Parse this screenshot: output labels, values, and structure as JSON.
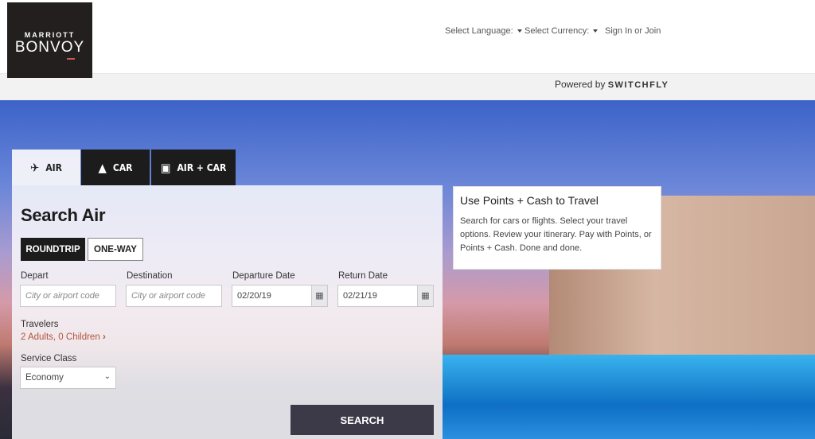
{
  "brand": {
    "line1": "MARRIOTT",
    "line2": "BONVOY"
  },
  "topnav": {
    "language": "Select Language:",
    "currency": "Select Currency:",
    "signin": "Sign In or Join"
  },
  "powered": {
    "prefix": "Powered by",
    "brand": "SWITCHFLY"
  },
  "tabs": [
    {
      "label": "AIR",
      "icon": "plane-icon",
      "active": true
    },
    {
      "label": "CAR",
      "icon": "road-icon"
    },
    {
      "label": "AIR + CAR",
      "icon": "suitcase-icon"
    }
  ],
  "form": {
    "title": "Search Air",
    "trip_types": [
      "ROUNDTRIP",
      "ONE-WAY"
    ],
    "selected_trip": "ROUNDTRIP",
    "depart": {
      "label": "Depart",
      "placeholder": "City or airport code"
    },
    "destination": {
      "label": "Destination",
      "placeholder": "City or airport code"
    },
    "departure_date": {
      "label": "Departure Date",
      "value": "02/20/19"
    },
    "return_date": {
      "label": "Return Date",
      "value": "02/21/19"
    },
    "travelers": {
      "label": "Travelers",
      "value": "2 Adults, 0 Children"
    },
    "service_class": {
      "label": "Service Class",
      "value": "Economy"
    },
    "search": "SEARCH"
  },
  "info": {
    "title": "Use Points + Cash to Travel",
    "body": "Search for cars or flights.  Select your travel options. Review your itinerary.  Pay with Points, or Points + Cash.  Done and done."
  },
  "colors": {
    "accent": "#b5533f",
    "dark": "#1c1c1c",
    "search_button": "#3c3a48"
  }
}
